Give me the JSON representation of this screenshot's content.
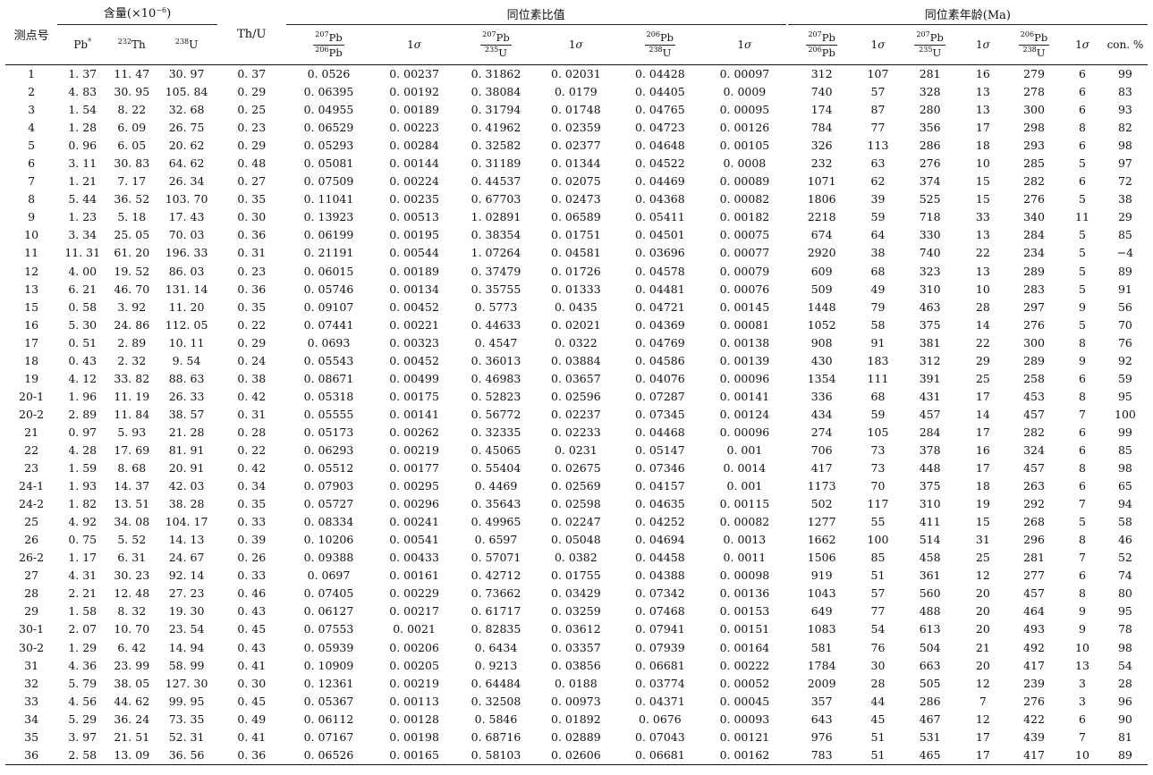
{
  "header": {
    "col_id": "测点号",
    "group_content": "含量(×10",
    "group_content_exp": "−6",
    "group_content_close": ")",
    "group_ratio": "同位素比值",
    "group_age": "同位素年龄(Ma)",
    "pb_star": "Pb",
    "pb_star_sup": "*",
    "th232_sup": "232",
    "th232": "Th",
    "u238_sup": "238",
    "u238": "U",
    "th_u": "Th/U",
    "sigma_pre": "1",
    "sigma": "σ",
    "con": "con. %",
    "r76_num_sup": "207",
    "r76_num": "Pb",
    "r76_den_sup": "206",
    "r76_den": "Pb",
    "r75_num_sup": "207",
    "r75_num": "Pb",
    "r75_den_sup": "235",
    "r75_den": "U",
    "r68_num_sup": "206",
    "r68_num": "Pb",
    "r68_den_sup": "238",
    "r68_den": "U"
  },
  "rows": [
    [
      "1",
      "1. 37",
      "11. 47",
      "30. 97",
      "0. 37",
      "0. 0526",
      "0. 00237",
      "0. 31862",
      "0. 02031",
      "0. 04428",
      "0. 00097",
      "312",
      "107",
      "281",
      "16",
      "279",
      "6",
      "99"
    ],
    [
      "2",
      "4. 83",
      "30. 95",
      "105. 84",
      "0. 29",
      "0. 06395",
      "0. 00192",
      "0. 38084",
      "0. 0179",
      "0. 04405",
      "0. 0009",
      "740",
      "57",
      "328",
      "13",
      "278",
      "6",
      "83"
    ],
    [
      "3",
      "1. 54",
      "8. 22",
      "32. 68",
      "0. 25",
      "0. 04955",
      "0. 00189",
      "0. 31794",
      "0. 01748",
      "0. 04765",
      "0. 00095",
      "174",
      "87",
      "280",
      "13",
      "300",
      "6",
      "93"
    ],
    [
      "4",
      "1. 28",
      "6. 09",
      "26. 75",
      "0. 23",
      "0. 06529",
      "0. 00223",
      "0. 41962",
      "0. 02359",
      "0. 04723",
      "0. 00126",
      "784",
      "77",
      "356",
      "17",
      "298",
      "8",
      "82"
    ],
    [
      "5",
      "0. 96",
      "6. 05",
      "20. 62",
      "0. 29",
      "0. 05293",
      "0. 00284",
      "0. 32582",
      "0. 02377",
      "0. 04648",
      "0. 00105",
      "326",
      "113",
      "286",
      "18",
      "293",
      "6",
      "98"
    ],
    [
      "6",
      "3. 11",
      "30. 83",
      "64. 62",
      "0. 48",
      "0. 05081",
      "0. 00144",
      "0. 31189",
      "0. 01344",
      "0. 04522",
      "0. 0008",
      "232",
      "63",
      "276",
      "10",
      "285",
      "5",
      "97"
    ],
    [
      "7",
      "1. 21",
      "7. 17",
      "26. 34",
      "0. 27",
      "0. 07509",
      "0. 00224",
      "0. 44537",
      "0. 02075",
      "0. 04469",
      "0. 00089",
      "1071",
      "62",
      "374",
      "15",
      "282",
      "6",
      "72"
    ],
    [
      "8",
      "5. 44",
      "36. 52",
      "103. 70",
      "0. 35",
      "0. 11041",
      "0. 00235",
      "0. 67703",
      "0. 02473",
      "0. 04368",
      "0. 00082",
      "1806",
      "39",
      "525",
      "15",
      "276",
      "5",
      "38"
    ],
    [
      "9",
      "1. 23",
      "5. 18",
      "17. 43",
      "0. 30",
      "0. 13923",
      "0. 00513",
      "1. 02891",
      "0. 06589",
      "0. 05411",
      "0. 00182",
      "2218",
      "59",
      "718",
      "33",
      "340",
      "11",
      "29"
    ],
    [
      "10",
      "3. 34",
      "25. 05",
      "70. 03",
      "0. 36",
      "0. 06199",
      "0. 00195",
      "0. 38354",
      "0. 01751",
      "0. 04501",
      "0. 00075",
      "674",
      "64",
      "330",
      "13",
      "284",
      "5",
      "85"
    ],
    [
      "11",
      "11. 31",
      "61. 20",
      "196. 33",
      "0. 31",
      "0. 21191",
      "0. 00544",
      "1. 07264",
      "0. 04581",
      "0. 03696",
      "0. 00077",
      "2920",
      "38",
      "740",
      "22",
      "234",
      "5",
      "−4"
    ],
    [
      "12",
      "4. 00",
      "19. 52",
      "86. 03",
      "0. 23",
      "0. 06015",
      "0. 00189",
      "0. 37479",
      "0. 01726",
      "0. 04578",
      "0. 00079",
      "609",
      "68",
      "323",
      "13",
      "289",
      "5",
      "89"
    ],
    [
      "13",
      "6. 21",
      "46. 70",
      "131. 14",
      "0. 36",
      "0. 05746",
      "0. 00134",
      "0. 35755",
      "0. 01333",
      "0. 04481",
      "0. 00076",
      "509",
      "49",
      "310",
      "10",
      "283",
      "5",
      "91"
    ],
    [
      "15",
      "0. 58",
      "3. 92",
      "11. 20",
      "0. 35",
      "0. 09107",
      "0. 00452",
      "0. 5773",
      "0. 0435",
      "0. 04721",
      "0. 00145",
      "1448",
      "79",
      "463",
      "28",
      "297",
      "9",
      "56"
    ],
    [
      "16",
      "5. 30",
      "24. 86",
      "112. 05",
      "0. 22",
      "0. 07441",
      "0. 00221",
      "0. 44633",
      "0. 02021",
      "0. 04369",
      "0. 00081",
      "1052",
      "58",
      "375",
      "14",
      "276",
      "5",
      "70"
    ],
    [
      "17",
      "0. 51",
      "2. 89",
      "10. 11",
      "0. 29",
      "0. 0693",
      "0. 00323",
      "0. 4547",
      "0. 0322",
      "0. 04769",
      "0. 00138",
      "908",
      "91",
      "381",
      "22",
      "300",
      "8",
      "76"
    ],
    [
      "18",
      "0. 43",
      "2. 32",
      "9. 54",
      "0. 24",
      "0. 05543",
      "0. 00452",
      "0. 36013",
      "0. 03884",
      "0. 04586",
      "0. 00139",
      "430",
      "183",
      "312",
      "29",
      "289",
      "9",
      "92"
    ],
    [
      "19",
      "4. 12",
      "33. 82",
      "88. 63",
      "0. 38",
      "0. 08671",
      "0. 00499",
      "0. 46983",
      "0. 03657",
      "0. 04076",
      "0. 00096",
      "1354",
      "111",
      "391",
      "25",
      "258",
      "6",
      "59"
    ],
    [
      "20-1",
      "1. 96",
      "11. 19",
      "26. 33",
      "0. 42",
      "0. 05318",
      "0. 00175",
      "0. 52823",
      "0. 02596",
      "0. 07287",
      "0. 00141",
      "336",
      "68",
      "431",
      "17",
      "453",
      "8",
      "95"
    ],
    [
      "20-2",
      "2. 89",
      "11. 84",
      "38. 57",
      "0. 31",
      "0. 05555",
      "0. 00141",
      "0. 56772",
      "0. 02237",
      "0. 07345",
      "0. 00124",
      "434",
      "59",
      "457",
      "14",
      "457",
      "7",
      "100"
    ],
    [
      "21",
      "0. 97",
      "5. 93",
      "21. 28",
      "0. 28",
      "0. 05173",
      "0. 00262",
      "0. 32335",
      "0. 02233",
      "0. 04468",
      "0. 00096",
      "274",
      "105",
      "284",
      "17",
      "282",
      "6",
      "99"
    ],
    [
      "22",
      "4. 28",
      "17. 69",
      "81. 91",
      "0. 22",
      "0. 06293",
      "0. 00219",
      "0. 45065",
      "0. 0231",
      "0. 05147",
      "0. 001",
      "706",
      "73",
      "378",
      "16",
      "324",
      "6",
      "85"
    ],
    [
      "23",
      "1. 59",
      "8. 68",
      "20. 91",
      "0. 42",
      "0. 05512",
      "0. 00177",
      "0. 55404",
      "0. 02675",
      "0. 07346",
      "0. 0014",
      "417",
      "73",
      "448",
      "17",
      "457",
      "8",
      "98"
    ],
    [
      "24-1",
      "1. 93",
      "14. 37",
      "42. 03",
      "0. 34",
      "0. 07903",
      "0. 00295",
      "0. 4469",
      "0. 02569",
      "0. 04157",
      "0. 001",
      "1173",
      "70",
      "375",
      "18",
      "263",
      "6",
      "65"
    ],
    [
      "24-2",
      "1. 82",
      "13. 51",
      "38. 28",
      "0. 35",
      "0. 05727",
      "0. 00296",
      "0. 35643",
      "0. 02598",
      "0. 04635",
      "0. 00115",
      "502",
      "117",
      "310",
      "19",
      "292",
      "7",
      "94"
    ],
    [
      "25",
      "4. 92",
      "34. 08",
      "104. 17",
      "0. 33",
      "0. 08334",
      "0. 00241",
      "0. 49965",
      "0. 02247",
      "0. 04252",
      "0. 00082",
      "1277",
      "55",
      "411",
      "15",
      "268",
      "5",
      "58"
    ],
    [
      "26",
      "0. 75",
      "5. 52",
      "14. 13",
      "0. 39",
      "0. 10206",
      "0. 00541",
      "0. 6597",
      "0. 05048",
      "0. 04694",
      "0. 0013",
      "1662",
      "100",
      "514",
      "31",
      "296",
      "8",
      "46"
    ],
    [
      "26-2",
      "1. 17",
      "6. 31",
      "24. 67",
      "0. 26",
      "0. 09388",
      "0. 00433",
      "0. 57071",
      "0. 0382",
      "0. 04458",
      "0. 0011",
      "1506",
      "85",
      "458",
      "25",
      "281",
      "7",
      "52"
    ],
    [
      "27",
      "4. 31",
      "30. 23",
      "92. 14",
      "0. 33",
      "0. 0697",
      "0. 00161",
      "0. 42712",
      "0. 01755",
      "0. 04388",
      "0. 00098",
      "919",
      "51",
      "361",
      "12",
      "277",
      "6",
      "74"
    ],
    [
      "28",
      "2. 21",
      "12. 48",
      "27. 23",
      "0. 46",
      "0. 07405",
      "0. 00229",
      "0. 73662",
      "0. 03429",
      "0. 07342",
      "0. 00136",
      "1043",
      "57",
      "560",
      "20",
      "457",
      "8",
      "80"
    ],
    [
      "29",
      "1. 58",
      "8. 32",
      "19. 30",
      "0. 43",
      "0. 06127",
      "0. 00217",
      "0. 61717",
      "0. 03259",
      "0. 07468",
      "0. 00153",
      "649",
      "77",
      "488",
      "20",
      "464",
      "9",
      "95"
    ],
    [
      "30-1",
      "2. 07",
      "10. 70",
      "23. 54",
      "0. 45",
      "0. 07553",
      "0. 0021",
      "0. 82835",
      "0. 03612",
      "0. 07941",
      "0. 00151",
      "1083",
      "54",
      "613",
      "20",
      "493",
      "9",
      "78"
    ],
    [
      "30-2",
      "1. 29",
      "6. 42",
      "14. 94",
      "0. 43",
      "0. 05939",
      "0. 00206",
      "0. 6434",
      "0. 03357",
      "0. 07939",
      "0. 00164",
      "581",
      "76",
      "504",
      "21",
      "492",
      "10",
      "98"
    ],
    [
      "31",
      "4. 36",
      "23. 99",
      "58. 99",
      "0. 41",
      "0. 10909",
      "0. 00205",
      "0. 9213",
      "0. 03856",
      "0. 06681",
      "0. 00222",
      "1784",
      "30",
      "663",
      "20",
      "417",
      "13",
      "54"
    ],
    [
      "32",
      "5. 79",
      "38. 05",
      "127. 30",
      "0. 30",
      "0. 12361",
      "0. 00219",
      "0. 64484",
      "0. 0188",
      "0. 03774",
      "0. 00052",
      "2009",
      "28",
      "505",
      "12",
      "239",
      "3",
      "28"
    ],
    [
      "33",
      "4. 56",
      "44. 62",
      "99. 95",
      "0. 45",
      "0. 05367",
      "0. 00113",
      "0. 32508",
      "0. 00973",
      "0. 04371",
      "0. 00045",
      "357",
      "44",
      "286",
      "7",
      "276",
      "3",
      "96"
    ],
    [
      "34",
      "5. 29",
      "36. 24",
      "73. 35",
      "0. 49",
      "0. 06112",
      "0. 00128",
      "0. 5846",
      "0. 01892",
      "0. 0676",
      "0. 00093",
      "643",
      "45",
      "467",
      "12",
      "422",
      "6",
      "90"
    ],
    [
      "35",
      "3. 97",
      "21. 51",
      "52. 31",
      "0. 41",
      "0. 07167",
      "0. 00198",
      "0. 68716",
      "0. 02889",
      "0. 07043",
      "0. 00121",
      "976",
      "51",
      "531",
      "17",
      "439",
      "7",
      "81"
    ],
    [
      "36",
      "2. 58",
      "13. 09",
      "36. 56",
      "0. 36",
      "0. 06526",
      "0. 00165",
      "0. 58103",
      "0. 02606",
      "0. 06681",
      "0. 00162",
      "783",
      "51",
      "465",
      "17",
      "417",
      "10",
      "89"
    ]
  ]
}
